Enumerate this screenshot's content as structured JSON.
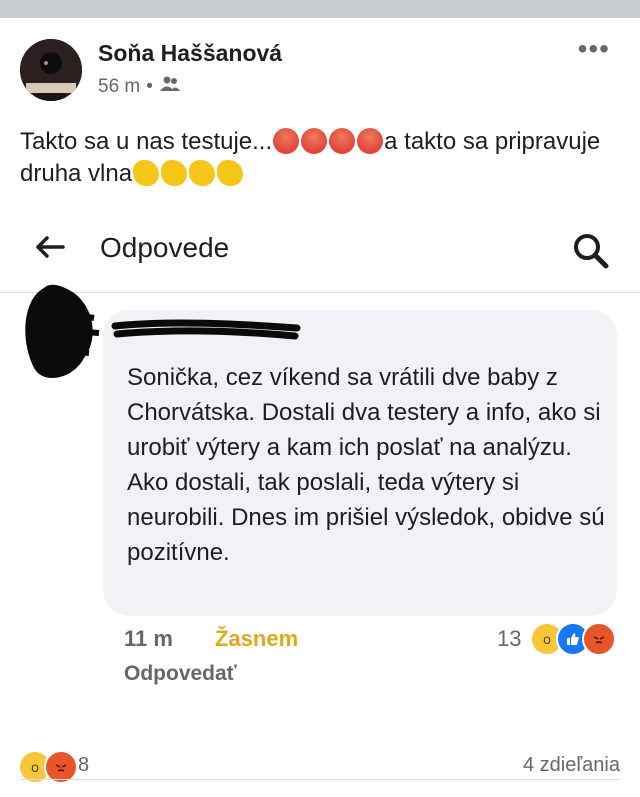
{
  "post": {
    "author": "Soňa Haššanová",
    "time": "56 m",
    "separator": "•",
    "privacy_icon": "group-icon",
    "text_part1": "Takto sa u nas testuje...",
    "text_part2": "a takto sa pripravuje druha vlna",
    "emoji_set1": "angry-face-emoji",
    "emoji_set2": "clapping-hands-emoji"
  },
  "replies_header": {
    "title": "Odpovede",
    "back_icon": "back-arrow-icon",
    "search_icon": "search-icon"
  },
  "comment": {
    "text": "Sonička, cez víkend sa vrátili dve baby z Chorvátska. Dostali dva testery a info, ako si urobiť výtery a kam ich poslať na analýzu. Ako dostali, tak poslali, teda výtery si neurobili. Dnes im prišiel výsledok, obidve sú pozitívne.",
    "time": "11 m",
    "react_label": "Žasnem",
    "reaction_count": "13",
    "reply_label": "Odpovedať"
  },
  "footer": {
    "reaction_count": "8",
    "shares": "4 zdieľania"
  },
  "colors": {
    "accent_react": "#e0a81b",
    "meta_grey": "#65676b",
    "bubble_bg": "#f0f2f5"
  }
}
